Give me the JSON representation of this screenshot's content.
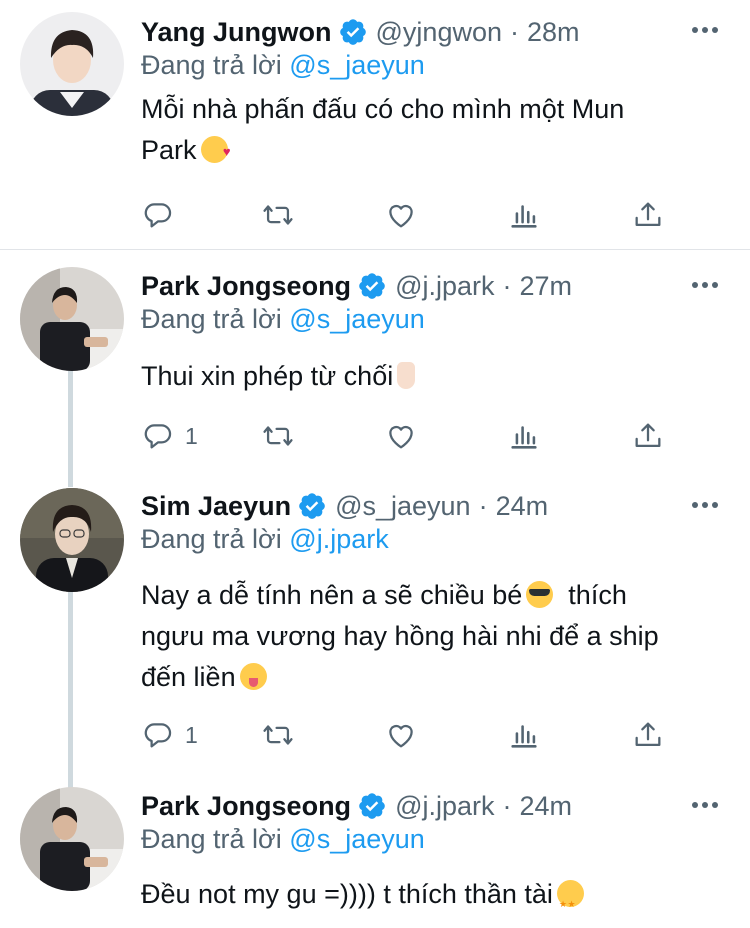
{
  "labels": {
    "reply_prefix": "Đang trả lời",
    "separator": "·"
  },
  "colors": {
    "accent": "#1d9bf0",
    "secondary_text": "#536471",
    "thread_line": "#cfd9de"
  },
  "icons": [
    "verified-badge-icon",
    "more-icon",
    "reply-icon",
    "retweet-icon",
    "like-icon",
    "analytics-icon",
    "share-icon"
  ],
  "tweets": [
    {
      "name": "Yang Jungwon",
      "handle": "@yjngwon",
      "time": "28m",
      "replying_to": "@s_jaeyun",
      "text_line1": "Mỗi nhà phấn đấu có cho mình một Mun",
      "text_line2": "Park",
      "emoji": "smiling-face-with-hearts",
      "reply_count": ""
    },
    {
      "name": "Park Jongseong",
      "handle": "@j.jpark",
      "time": "27m",
      "replying_to": "@s_jaeyun",
      "text_line1": "Thui xin phép từ chối",
      "emoji": "index-pointing-up",
      "reply_count": "1"
    },
    {
      "name": "Sim Jaeyun",
      "handle": "@s_jaeyun",
      "time": "24m",
      "replying_to": "@j.jpark",
      "text_line1_a": "Nay a dễ tính nên a sẽ chiều bé",
      "text_line1_b": "thích",
      "text_line2": "ngưu ma vương hay hồng hài nhi để a ship",
      "text_line3": "đến liền",
      "emoji1": "smiling-face-with-sunglasses",
      "emoji2": "squinting-face-with-tongue",
      "reply_count": "1"
    },
    {
      "name": "Park Jongseong",
      "handle": "@j.jpark",
      "time": "24m",
      "replying_to": "@s_jaeyun",
      "text_line1": "Đều not my gu =)))) t thích thần tài",
      "emoji": "star-struck"
    }
  ]
}
